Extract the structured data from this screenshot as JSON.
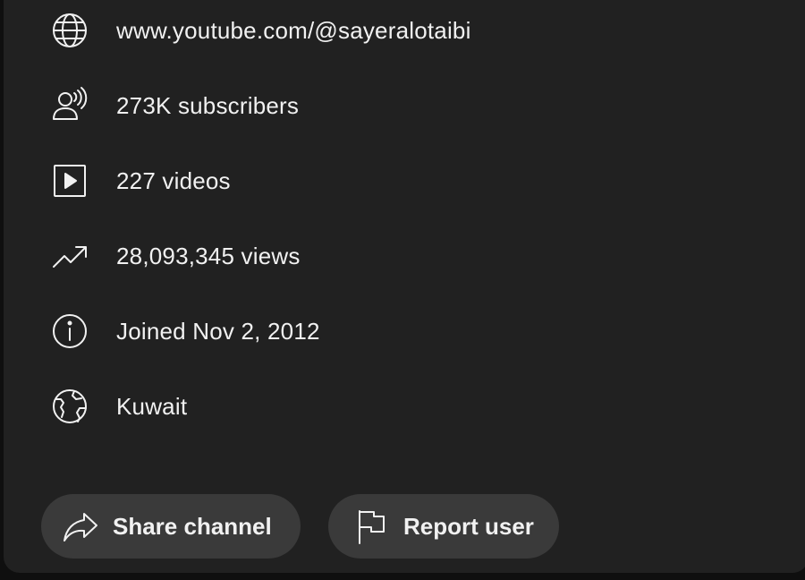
{
  "about": {
    "rows": [
      {
        "icon": "globe-icon",
        "text": "www.youtube.com/@sayeralotaibi"
      },
      {
        "icon": "subscribers-icon",
        "text": "273K subscribers"
      },
      {
        "icon": "video-play-icon",
        "text": "227 videos"
      },
      {
        "icon": "trending-up-icon",
        "text": "28,093,345 views"
      },
      {
        "icon": "info-icon",
        "text": "Joined Nov 2, 2012"
      },
      {
        "icon": "world-location-icon",
        "text": "Kuwait"
      }
    ]
  },
  "actions": {
    "share_label": "Share channel",
    "report_label": "Report user"
  },
  "colors": {
    "dialog_bg": "#212121",
    "button_bg": "#3a3a3a",
    "text": "#f1f1f1",
    "backdrop": "#0f0f0f"
  }
}
